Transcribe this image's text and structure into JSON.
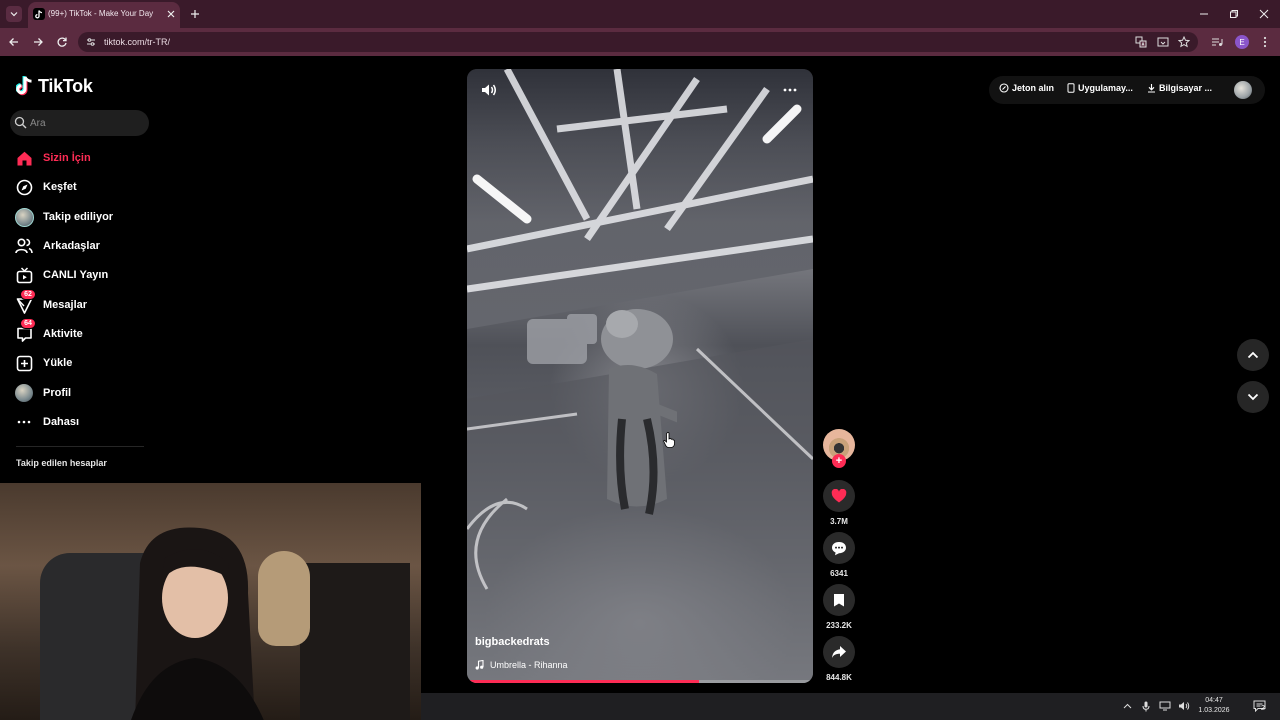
{
  "browser": {
    "tab_title": "(99+) TikTok - Make Your Day",
    "url": "tiktok.com/tr-TR/",
    "profile_initial": "E"
  },
  "tiktok": {
    "logo_text": "TikTok",
    "search_placeholder": "Ara",
    "nav": [
      {
        "label": "Sizin İçin",
        "icon": "home-icon",
        "active": true
      },
      {
        "label": "Keşfet",
        "icon": "compass-icon"
      },
      {
        "label": "Takip ediliyor",
        "icon": "following-avatar-icon"
      },
      {
        "label": "Arkadaşlar",
        "icon": "friends-icon"
      },
      {
        "label": "CANLI Yayın",
        "icon": "live-tv-icon"
      },
      {
        "label": "Mesajlar",
        "icon": "messages-icon",
        "badge": "62"
      },
      {
        "label": "Aktivite",
        "icon": "activity-icon",
        "badge": "64"
      },
      {
        "label": "Yükle",
        "icon": "upload-icon"
      },
      {
        "label": "Profil",
        "icon": "profile-avatar-icon"
      },
      {
        "label": "Dahası",
        "icon": "more-dots-icon"
      }
    ],
    "following_title": "Takip edilen hesaplar",
    "top_right": {
      "coins": "Jeton alın",
      "app": "Uygulamay...",
      "desktop": "Bilgisayar ..."
    },
    "video": {
      "username": "bigbackedrats",
      "music": "Umbrella - Rihanna",
      "progress": 0.67
    },
    "actions": {
      "likes": "3.7M",
      "comments": "6341",
      "saves": "233.2K",
      "shares": "844.8K"
    }
  },
  "taskbar": {
    "time": "04:47",
    "date": "1.03.2026",
    "notifications": "2"
  },
  "colors": {
    "brand_red": "#fe2c55",
    "chrome_tab": "#5b2b40"
  }
}
